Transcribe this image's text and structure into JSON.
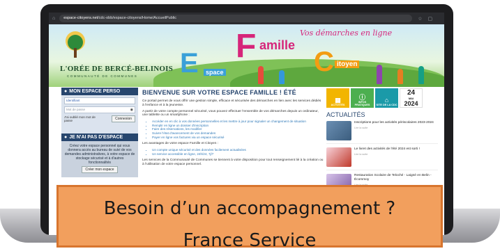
{
  "browser": {
    "url_host": "espace-citoyens.net",
    "url_path": "/cdc-obb/espace-citoyens/Home/AccueilPublic"
  },
  "banner": {
    "logo_name": "L'ORÉE DE BERCÉ-BELINOIS",
    "logo_sub": "COMMUNAUTÉ DE COMMUNES",
    "slogan": "Vos démarches en ligne",
    "letter_e": "E",
    "letter_f": "F",
    "letter_c": "C",
    "word_espace": "space",
    "word_amille": "amille",
    "word_itoyen": "itoyen"
  },
  "left": {
    "perso_title": "MON ESPACE PERSO",
    "identifiant": "Identifiant",
    "password": "Mot de passe",
    "forgot": "J'ai oublié mon mot de passe",
    "connect": "Connexion",
    "notyet_title": "JE N'AI PAS D'ESPACE",
    "notyet_text": "Créez votre espace personnel qui vous donnera accès au bureau de suivi de vos demandes administratives, à votre espace de stockage sécurisé et à d'autres fonctionnalités",
    "create": "Créer mon espace"
  },
  "main": {
    "title": "BIENVENUE SUR VOTRE ESPACE FAMILLE ! ÉTÉ",
    "intro": "Ce portail permet de vous offrir une gestion simple, efficace et sécurisée des démarches en lien avec les services dédiés à l'enfance et à la jeunesse.",
    "intro2": "A partir de votre compte personnel sécurisé, vous pouvez effectuer l'ensemble de vos démarches depuis un ordinateur, une tablette ou un smartphone :",
    "list1": [
      "Accéder en en clic à vos données personnelles et les mettre à jour pour signaler un changement de situation",
      "Remplir en ligne un dossier d'inscription",
      "Faire des réservations, les modifier",
      "Suivre l'état d'avancement de vos demandes",
      "Payer en ligne vos factures via un espace sécurisé"
    ],
    "advantages": "Les avantages de votre espace Famille et Citoyen :",
    "list2": [
      "Un compte unique sécurisé et des données facilement actualisées",
      "Un service accessible en ligne, 24h/24, 7j/7"
    ],
    "services": "Les services de la Communauté de Communes se tiennent à votre disposition pour tout renseignement lié à la création ou à l'utilisation de votre espace personnel."
  },
  "right": {
    "tiles": [
      {
        "label": "ACTIVITÉS",
        "icon": "calendar-icon"
      },
      {
        "label": "INFOS PRATIQUES",
        "icon": "info-icon"
      },
      {
        "label": "SITE DE LA CDC",
        "icon": "home-icon"
      }
    ],
    "date_day": "24",
    "date_month": "MAI",
    "date_year": "2024",
    "news_title": "ACTUALITÉS",
    "news": [
      {
        "title": "Inscriptions pour les activités périscolaires 2023-2024",
        "more": "Lire la suite"
      },
      {
        "title": "Le livret des activités de l'été 2024 est sorti !",
        "more": "Lire la suite"
      },
      {
        "title": "Restauration Scolaire de Teloché - Laigné en Belin - Écommoy",
        "more": "Lire la suite"
      }
    ]
  },
  "overlay": {
    "line1": "Besoin d’un accompagnement ?",
    "line2": "France Service"
  },
  "colors": {
    "navy": "#27466e",
    "overlay": "#f29f5d",
    "magenta": "#d6257a",
    "blue": "#3aa0d8",
    "orange": "#f39c12"
  }
}
